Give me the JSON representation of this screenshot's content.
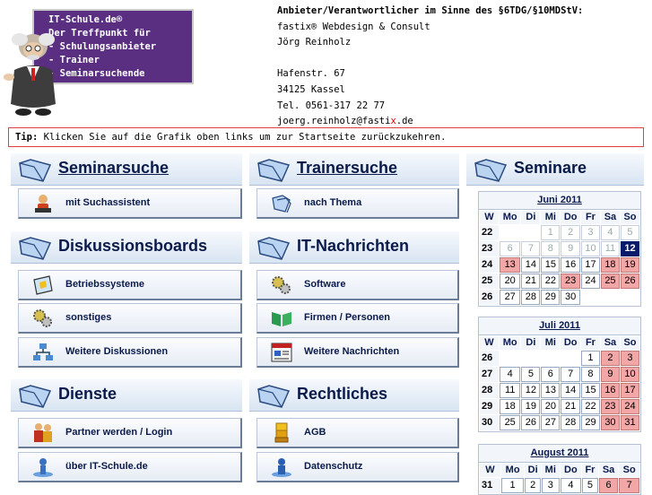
{
  "logo": {
    "lines": [
      "IT-Schule.de®",
      "Der Treffpunkt für",
      "- Schulungsanbieter",
      "- Trainer",
      "- Seminarsuchende"
    ]
  },
  "imprint": {
    "heading": "Anbieter/Verantwortlicher im Sinne des §6TDG/§10MDStV:",
    "company": "fastix® Webdesign & Consult",
    "person": "Jörg Reinholz",
    "street": "Hafenstr. 67",
    "city": "34125 Kassel",
    "phone": "Tel. 0561-317 22 77",
    "email_pre": "joerg.reinholz@fasti",
    "email_x": "x",
    "email_post": ".de"
  },
  "tip": {
    "label": "Tip:",
    "text": " Klicken Sie auf die Grafik oben links um zur Startseite zurückzukehren."
  },
  "sections": {
    "seminarsuche": {
      "title": "Seminarsuche",
      "items": [
        "mit Suchassistent"
      ]
    },
    "trainersuche": {
      "title": "Trainersuche",
      "items": [
        "nach Thema"
      ]
    },
    "seminare": {
      "title": "Seminare"
    },
    "diskussionsboards": {
      "title": "Diskussionsboards",
      "items": [
        "Betriebssysteme",
        "sonstiges",
        "Weitere Diskussionen"
      ]
    },
    "itnachrichten": {
      "title": "IT-Nachrichten",
      "items": [
        "Software",
        "Firmen / Personen",
        "Weitere Nachrichten"
      ]
    },
    "dienste": {
      "title": "Dienste",
      "items": [
        "Partner werden / Login",
        "über IT-Schule.de"
      ]
    },
    "rechtliches": {
      "title": "Rechtliches",
      "items": [
        "AGB",
        "Datenschutz"
      ]
    }
  },
  "calendar_headers": [
    "W",
    "Mo",
    "Di",
    "Mi",
    "Do",
    "Fr",
    "Sa",
    "So"
  ],
  "calendars": [
    {
      "title": "Juni 2011",
      "weeks": [
        {
          "w": "22",
          "days": [
            "",
            "",
            "1",
            "2",
            "3",
            "4",
            "5"
          ]
        },
        {
          "w": "23",
          "days": [
            "6",
            "7",
            "8",
            "9",
            "10",
            "11",
            "12"
          ]
        },
        {
          "w": "24",
          "days": [
            "13",
            "14",
            "15",
            "16",
            "17",
            "18",
            "19"
          ]
        },
        {
          "w": "25",
          "days": [
            "20",
            "21",
            "22",
            "23",
            "24",
            "25",
            "26"
          ]
        },
        {
          "w": "26",
          "days": [
            "27",
            "28",
            "29",
            "30",
            "",
            "",
            ""
          ]
        }
      ]
    },
    {
      "title": "Juli 2011",
      "weeks": [
        {
          "w": "26",
          "days": [
            "",
            "",
            "",
            "",
            "1",
            "2",
            "3"
          ]
        },
        {
          "w": "27",
          "days": [
            "4",
            "5",
            "6",
            "7",
            "8",
            "9",
            "10"
          ]
        },
        {
          "w": "28",
          "days": [
            "11",
            "12",
            "13",
            "14",
            "15",
            "16",
            "17"
          ]
        },
        {
          "w": "29",
          "days": [
            "18",
            "19",
            "20",
            "21",
            "22",
            "23",
            "24"
          ]
        },
        {
          "w": "30",
          "days": [
            "25",
            "26",
            "27",
            "28",
            "29",
            "30",
            "31"
          ]
        }
      ]
    },
    {
      "title": "August 2011",
      "weeks": [
        {
          "w": "31",
          "days": [
            "1",
            "2",
            "3",
            "4",
            "5",
            "6",
            "7"
          ]
        }
      ]
    }
  ],
  "colors": {
    "weekend": "#f2a6a6",
    "today": "#0a1a6a",
    "tip_border": "#e04040",
    "logo_bg": "#5a2e80"
  },
  "icons": {
    "section": "folder-icon",
    "mit Suchassistent": "assistant-icon",
    "nach Thema": "folders-icon",
    "Betriebssysteme": "window-icon",
    "sonstiges": "gears-icon",
    "Weitere Diskussionen": "network-icon",
    "Software": "gears-icon",
    "Firmen / Personen": "book-icon",
    "Weitere Nachrichten": "newspaper-icon",
    "Partner werden / Login": "people-icon",
    "über IT-Schule.de": "info-icon",
    "AGB": "document-stack-icon",
    "Datenschutz": "person-icon"
  }
}
